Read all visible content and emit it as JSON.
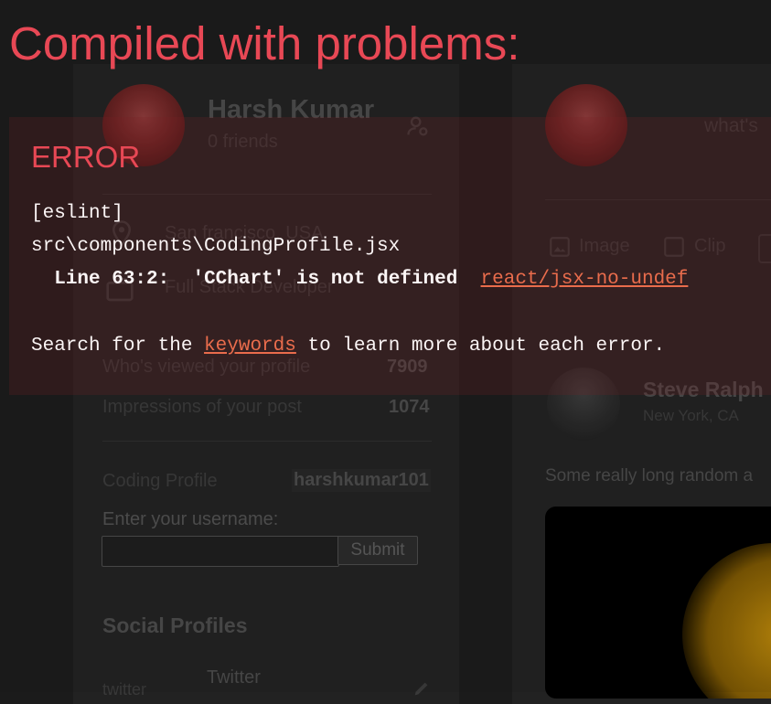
{
  "overlay": {
    "title": "Compiled with problems:",
    "heading": "ERROR",
    "tool": "[eslint]",
    "file": "src\\components\\CodingProfile.jsx",
    "line_label": "Line 63:2:",
    "message": "'CChart' is not defined",
    "rule": "react/jsx-no-undef",
    "hint_prefix": "Search for the",
    "hint_link": "keywords",
    "hint_suffix": "to learn more about each error.",
    "colors": {
      "accent": "#e84855",
      "link": "#e96c4c",
      "box": "#7d1e23"
    }
  },
  "profile": {
    "name": "Harsh Kumar",
    "friends": "0 friends",
    "location": "San francisco, USA",
    "occupation": "Full Stack Developer",
    "stats": [
      {
        "label": "Who's viewed your profile",
        "value": "7909"
      },
      {
        "label": "Impressions of your post",
        "value": "1074"
      }
    ],
    "coding_profile_label": "Coding Profile",
    "coding_profile_value": "harshkumar101",
    "username_label": "Enter your username:",
    "username_value": "",
    "submit_label": "Submit",
    "social_title": "Social Profiles",
    "social_items": [
      {
        "alt": "twitter",
        "name": "Twitter"
      }
    ]
  },
  "post_composer": {
    "placeholder": "what's",
    "actions": [
      "Image",
      "Clip"
    ]
  },
  "post": {
    "author": "Steve Ralph",
    "location": "New York, CA",
    "text": "Some really long random a"
  },
  "icons": {
    "manage_account": "manage-account-icon",
    "location": "location-pin-icon",
    "work": "briefcase-icon",
    "image": "image-icon",
    "clip": "gif-icon",
    "edit": "edit-pencil-icon"
  }
}
